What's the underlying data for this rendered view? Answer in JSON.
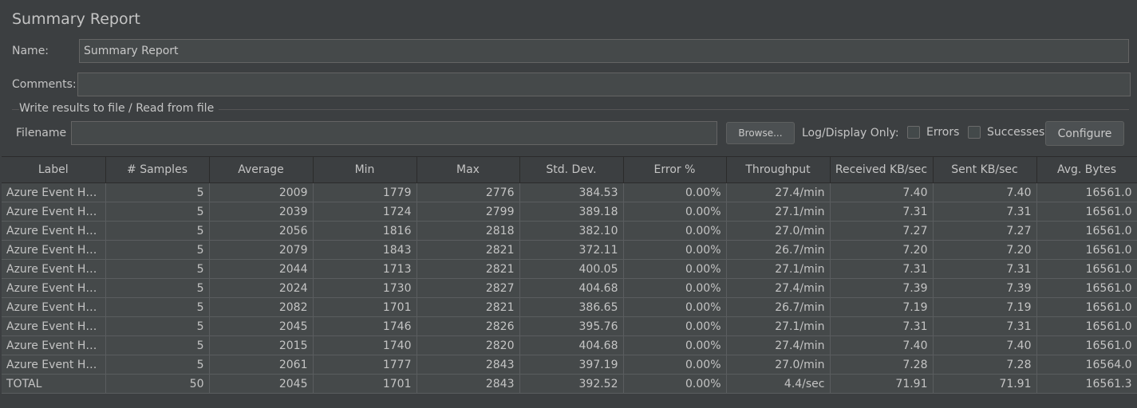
{
  "title": "Summary Report",
  "name_label": "Name:",
  "name_value": "Summary Report",
  "comments_label": "Comments:",
  "comments_value": "",
  "file_group_title": "Write results to file / Read from file",
  "filename_label": "Filename",
  "filename_value": "",
  "browse_label": "Browse...",
  "log_display_label": "Log/Display Only:",
  "errors_label": "Errors",
  "successes_label": "Successes",
  "configure_label": "Configure",
  "table": {
    "headers": [
      "Label",
      "# Samples",
      "Average",
      "Min",
      "Max",
      "Std. Dev.",
      "Error %",
      "Throughput",
      "Received KB/sec",
      "Sent KB/sec",
      "Avg. Bytes"
    ],
    "rows": [
      [
        "Azure Event Hub...",
        "5",
        "2009",
        "1779",
        "2776",
        "384.53",
        "0.00%",
        "27.4/min",
        "7.40",
        "7.40",
        "16561.0"
      ],
      [
        "Azure Event Hub...",
        "5",
        "2039",
        "1724",
        "2799",
        "389.18",
        "0.00%",
        "27.1/min",
        "7.31",
        "7.31",
        "16561.0"
      ],
      [
        "Azure Event Hub...",
        "5",
        "2056",
        "1816",
        "2818",
        "382.10",
        "0.00%",
        "27.0/min",
        "7.27",
        "7.27",
        "16561.0"
      ],
      [
        "Azure Event Hub...",
        "5",
        "2079",
        "1843",
        "2821",
        "372.11",
        "0.00%",
        "26.7/min",
        "7.20",
        "7.20",
        "16561.0"
      ],
      [
        "Azure Event Hub...",
        "5",
        "2044",
        "1713",
        "2821",
        "400.05",
        "0.00%",
        "27.1/min",
        "7.31",
        "7.31",
        "16561.0"
      ],
      [
        "Azure Event Hub...",
        "5",
        "2024",
        "1730",
        "2827",
        "404.68",
        "0.00%",
        "27.4/min",
        "7.39",
        "7.39",
        "16561.0"
      ],
      [
        "Azure Event Hub...",
        "5",
        "2082",
        "1701",
        "2821",
        "386.65",
        "0.00%",
        "26.7/min",
        "7.19",
        "7.19",
        "16561.0"
      ],
      [
        "Azure Event Hub...",
        "5",
        "2045",
        "1746",
        "2826",
        "395.76",
        "0.00%",
        "27.1/min",
        "7.31",
        "7.31",
        "16561.0"
      ],
      [
        "Azure Event Hub...",
        "5",
        "2015",
        "1740",
        "2820",
        "404.68",
        "0.00%",
        "27.4/min",
        "7.40",
        "7.40",
        "16561.0"
      ],
      [
        "Azure Event Hub...",
        "5",
        "2061",
        "1777",
        "2843",
        "397.19",
        "0.00%",
        "27.0/min",
        "7.28",
        "7.28",
        "16564.0"
      ],
      [
        "TOTAL",
        "50",
        "2045",
        "1701",
        "2843",
        "392.52",
        "0.00%",
        "4.4/sec",
        "71.91",
        "71.91",
        "16561.3"
      ]
    ]
  },
  "colors": {
    "background": "#3c3f41",
    "field_background": "#45494a",
    "text": "#c4c4c4"
  }
}
